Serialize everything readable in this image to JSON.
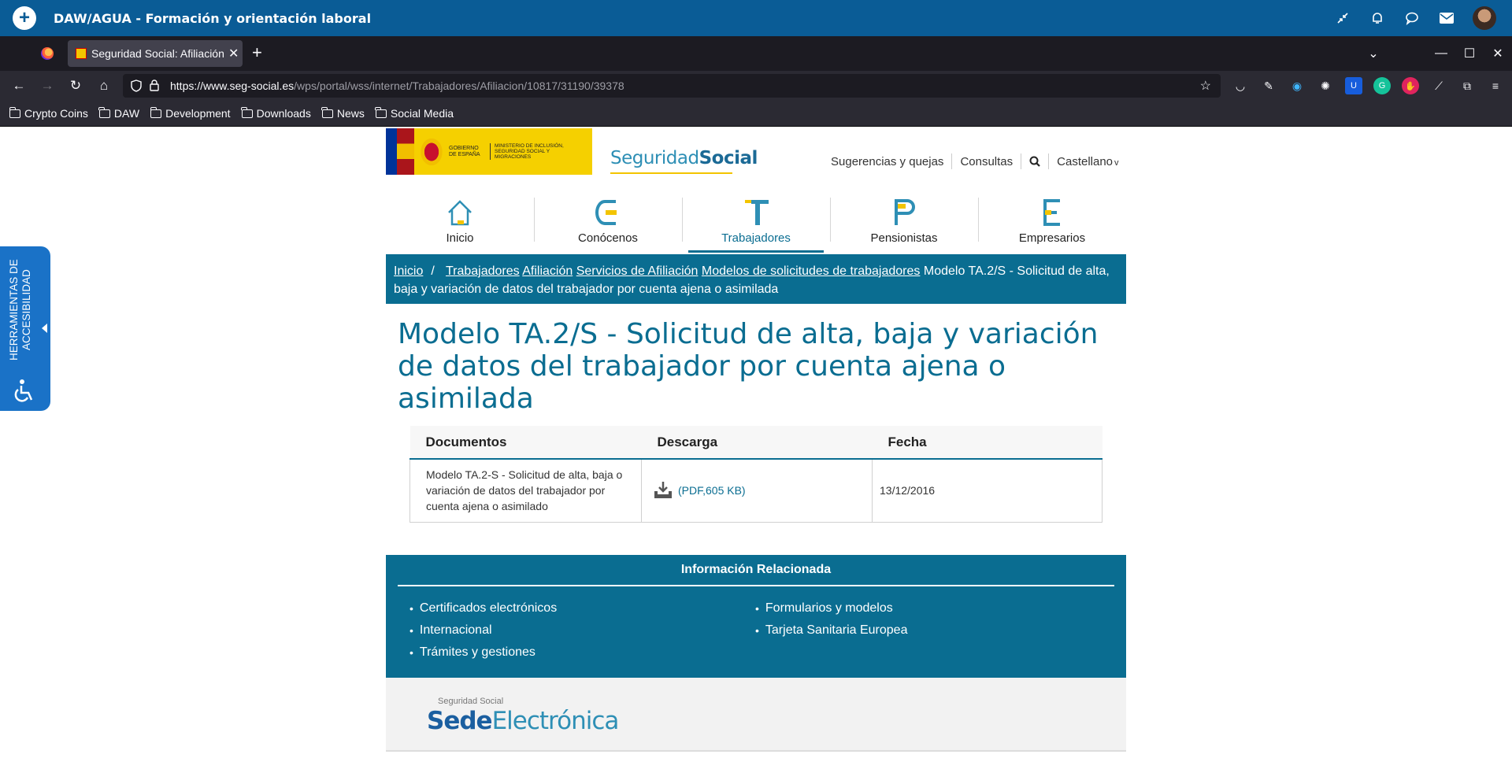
{
  "app": {
    "title": "DAW/AGUA - Formación y orientación laboral"
  },
  "browser": {
    "tab_title": "Seguridad Social: Afiliación",
    "url_domain": "https://www.seg-social.es",
    "url_path": "/wps/portal/wss/internet/Trabajadores/Afiliacion/10817/31190/39378",
    "bookmarks": [
      "Crypto Coins",
      "DAW",
      "Development",
      "Downloads",
      "News",
      "Social Media"
    ]
  },
  "site": {
    "gov_text": "GOBIERNO DE ESPAÑA",
    "ministry_text": "MINISTERIO DE INCLUSIÓN, SEGURIDAD SOCIAL Y MIGRACIONES",
    "brand_light": "Seguridad",
    "brand_bold": "Social",
    "top_links": {
      "suggestions": "Sugerencias y quejas",
      "consultas": "Consultas",
      "language": "Castellano"
    },
    "menu": [
      "Inicio",
      "Conócenos",
      "Trabajadores",
      "Pensionistas",
      "Empresarios"
    ]
  },
  "breadcrumb": {
    "items": [
      "Inicio",
      "Trabajadores",
      "Afiliación",
      "Servicios de Afiliación",
      "Modelos de solicitudes de trabajadores"
    ],
    "current": "Modelo TA.2/S - Solicitud de alta, baja y variación de datos del trabajador por cuenta ajena o asimilada"
  },
  "page_title": "Modelo TA.2/S - Solicitud de alta, baja y variación de datos del trabajador por cuenta ajena o asimilada",
  "table": {
    "headers": [
      "Documentos",
      "Descarga",
      "Fecha"
    ],
    "rows": [
      {
        "document": "Modelo TA.2-S - Solicitud de alta, baja o variación de datos del trabajador por cuenta ajena o asimilado",
        "download": "(PDF,605 KB)",
        "date": "13/12/2016"
      }
    ]
  },
  "related": {
    "title": "Información Relacionada",
    "col1": [
      "Certificados electrónicos",
      "Internacional",
      "Trámites y gestiones"
    ],
    "col2": [
      "Formularios y modelos",
      "Tarjeta Sanitaria Europea"
    ]
  },
  "sede": {
    "small": "Seguridad Social",
    "bold": "Sede",
    "light": "Electrónica"
  },
  "accessibility": {
    "label": "HERRAMIENTAS DE ACCESIBILIDAD"
  }
}
